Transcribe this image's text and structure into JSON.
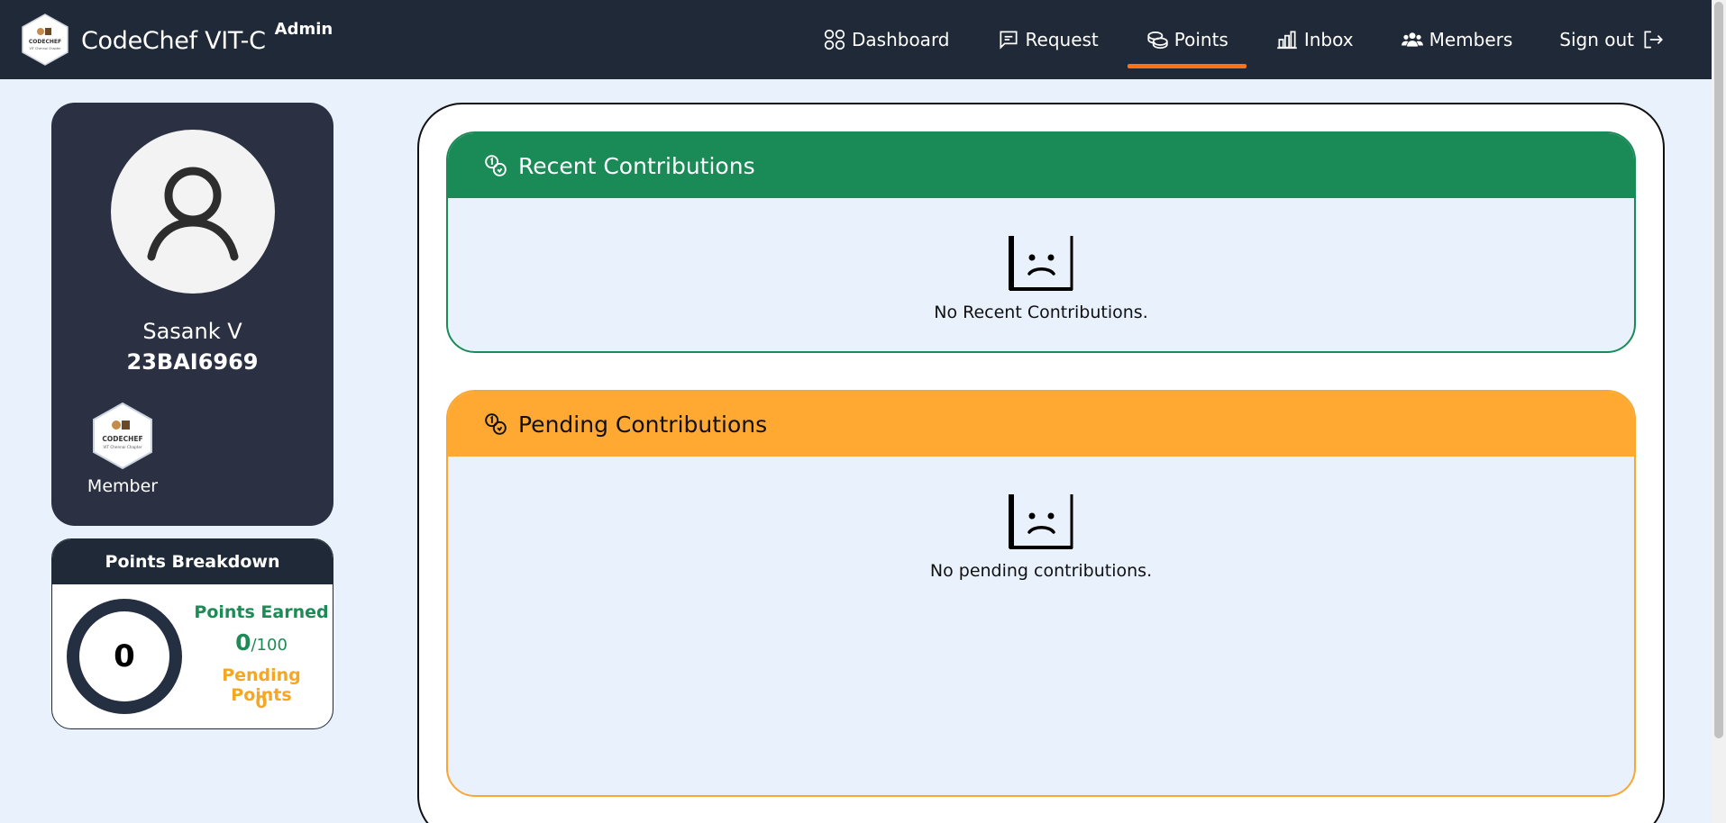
{
  "brand": {
    "name": "CodeChef VIT-C",
    "role": "Admin",
    "logo_text_1": "CODECHEF",
    "logo_text_2": "VIT Chennai Chapter"
  },
  "nav": {
    "items": [
      {
        "label": "Dashboard",
        "icon": "dashboard-grid-icon"
      },
      {
        "label": "Request",
        "icon": "message-square-icon"
      },
      {
        "label": "Points",
        "icon": "coins-icon",
        "active": true
      },
      {
        "label": "Inbox",
        "icon": "bar-chart-icon"
      },
      {
        "label": "Members",
        "icon": "users-icon"
      },
      {
        "label": "Sign out",
        "icon": "sign-out-icon"
      }
    ]
  },
  "profile": {
    "name": "Sasank V",
    "reg_no": "23BAI6969",
    "badge_label": "Member"
  },
  "breakdown": {
    "title": "Points Breakdown",
    "total": "0",
    "earned_label": "Points Earned",
    "earned_value": "0",
    "earned_max": "/100",
    "pending_label": "Pending Points",
    "pending_value": "0"
  },
  "recent": {
    "title": "Recent Contributions",
    "empty_text": "No Recent Contributions."
  },
  "pending": {
    "title": "Pending Contributions",
    "empty_text": "No pending contributions."
  },
  "colors": {
    "navbar": "#1f2937",
    "accent": "#f97316",
    "green": "#1a8a56",
    "orange": "#ffa832"
  }
}
